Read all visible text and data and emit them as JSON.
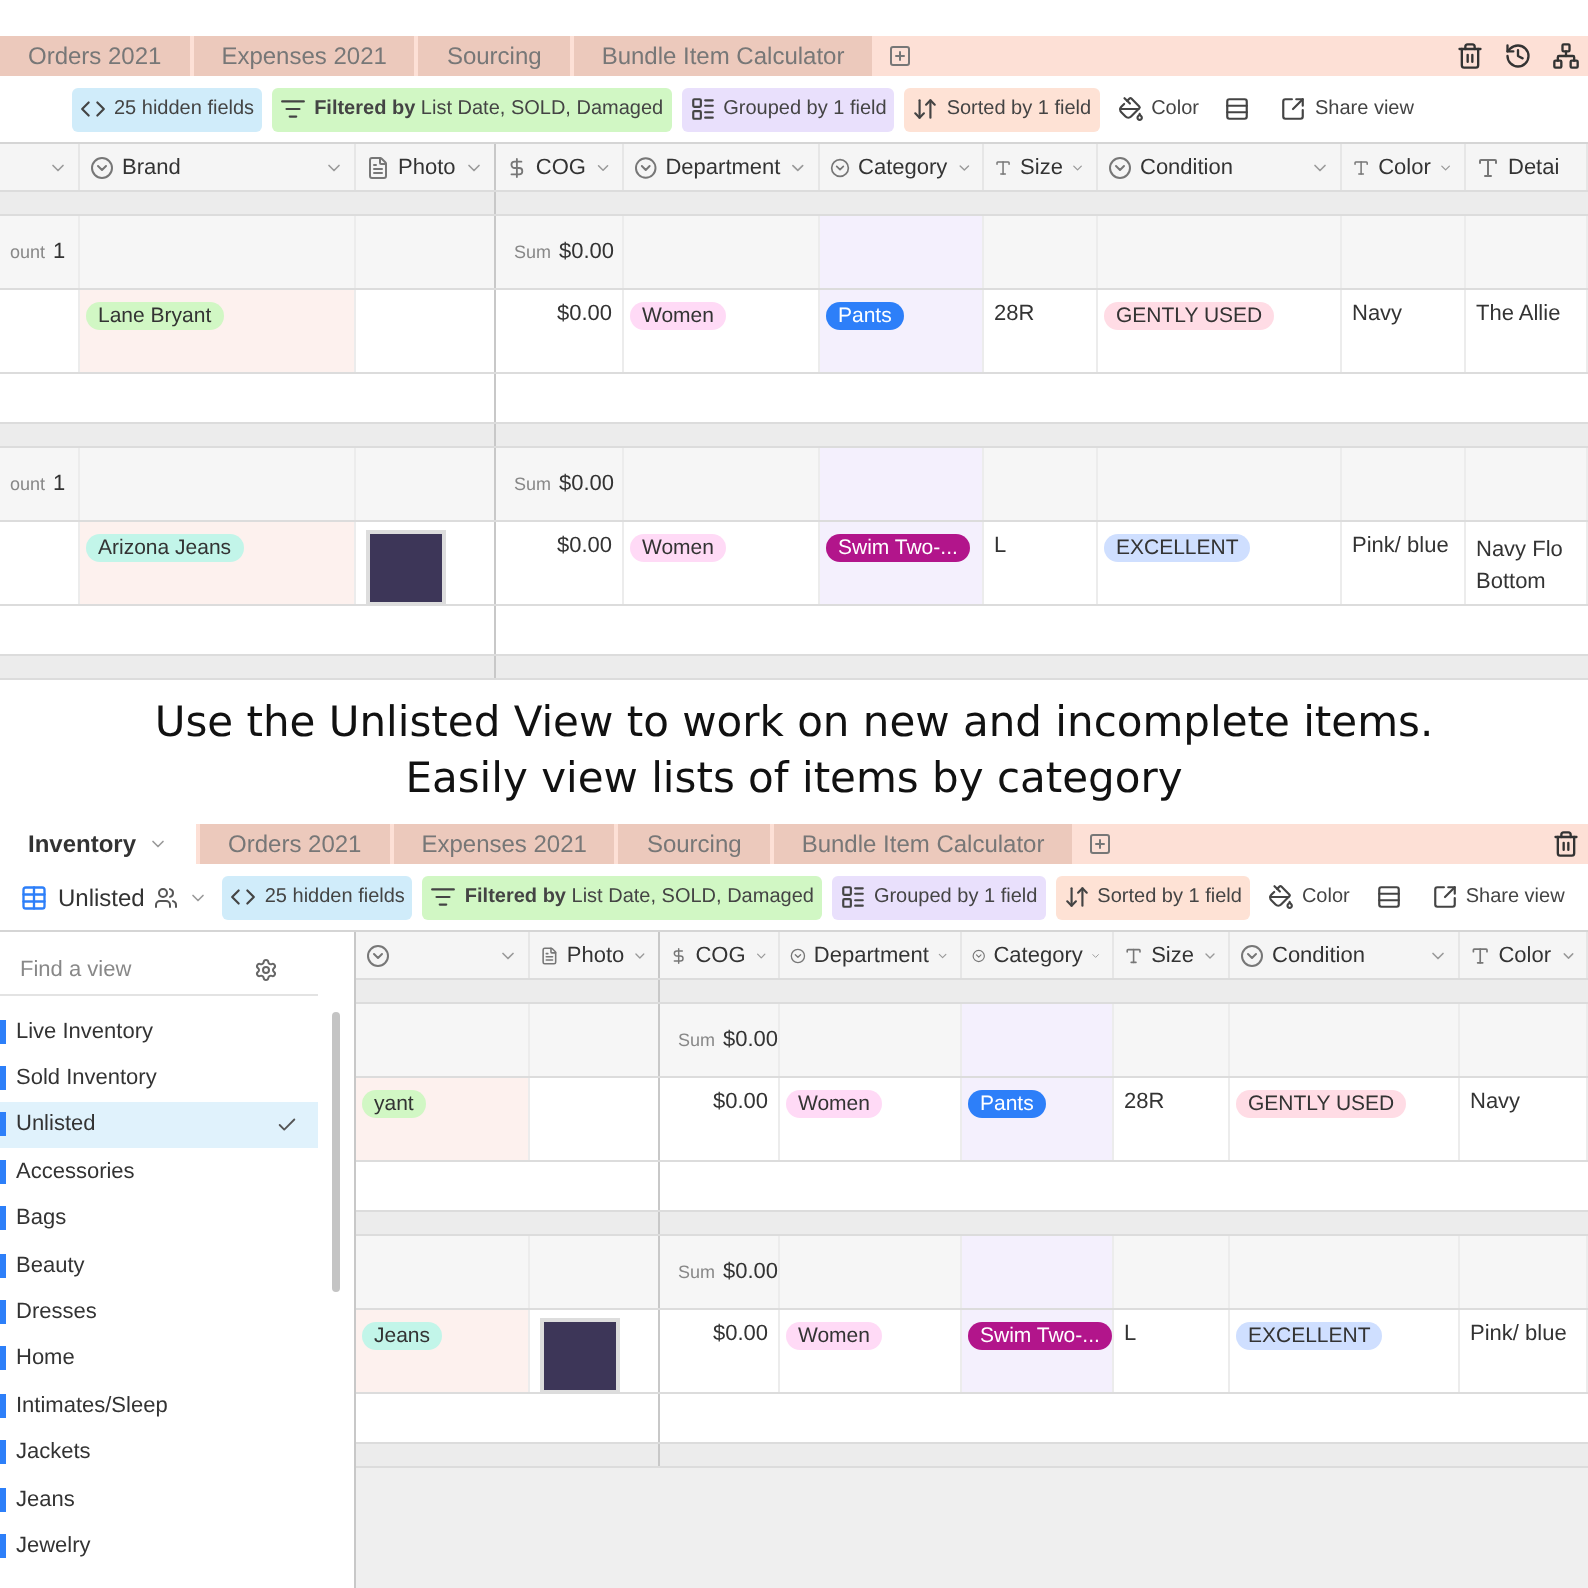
{
  "top_view": {
    "tabs": [
      {
        "label": "Orders 2021",
        "selected": false
      },
      {
        "label": "Expenses 2021",
        "selected": false
      },
      {
        "label": "Sourcing",
        "selected": false
      },
      {
        "label": "Bundle Item Calculator",
        "selected": false
      }
    ],
    "toolbar": [
      {
        "kind": "hidden",
        "label": "25 hidden fields"
      },
      {
        "kind": "filter",
        "label": "**Filtered by** List Date, SOLD, Damaged"
      },
      {
        "kind": "group",
        "label": "Grouped by 1 field"
      },
      {
        "kind": "sort",
        "label": "Sorted by 1 field"
      },
      {
        "kind": "color",
        "label": "Color"
      },
      {
        "kind": "row_height"
      },
      {
        "kind": "share",
        "label": "Share view"
      }
    ],
    "columns": [
      {
        "kind": "primary"
      },
      {
        "kind": "select",
        "label": "Brand",
        "sorted": true
      },
      {
        "kind": "attachment",
        "label": "Photo"
      },
      {
        "kind": "currency",
        "label": "COG"
      },
      {
        "kind": "select",
        "label": "Department"
      },
      {
        "kind": "select",
        "label": "Category",
        "grouped": true
      },
      {
        "kind": "text",
        "label": "Size"
      },
      {
        "kind": "select",
        "label": "Condition"
      },
      {
        "kind": "text",
        "label": "Color"
      },
      {
        "kind": "text",
        "label": "Detai"
      }
    ],
    "groups": [
      {
        "count_label": "ount",
        "count": "1",
        "sum_label": "Sum",
        "sum": "$0.00",
        "cells": [
          null,
          {
            "kind": "pill",
            "text": "Lane Bryant",
            "color": "#d1f7c4"
          },
          null,
          {
            "kind": "text",
            "text": "$0.00"
          },
          {
            "kind": "pill",
            "text": "Women",
            "color": "#ffdaf6"
          },
          {
            "kind": "pill",
            "text": "Pants",
            "color": "#2d7ff9"
          },
          {
            "kind": "text",
            "text": "28R"
          },
          {
            "kind": "pill",
            "text": "GENTLY USED",
            "color": "#ffdce5"
          },
          {
            "kind": "text",
            "text": "Navy"
          },
          {
            "kind": "text",
            "text": "The Allie"
          }
        ]
      },
      {
        "count_label": "ount",
        "count": "1",
        "sum_label": "Sum",
        "sum": "$0.00",
        "cells": [
          null,
          {
            "kind": "pill",
            "text": "Arizona Jeans",
            "color": "#c2f5e9"
          },
          {
            "kind": "photo"
          },
          {
            "kind": "text",
            "text": "$0.00"
          },
          {
            "kind": "pill",
            "text": "Women",
            "color": "#ffdaf6"
          },
          {
            "kind": "pill",
            "text": "Swim Two-...",
            "color": "#b2158b"
          },
          {
            "kind": "text",
            "text": "L"
          },
          {
            "kind": "pill",
            "text": "EXCELLENT",
            "color": "#cfdfff"
          },
          {
            "kind": "text",
            "text": "Pink/ blue"
          },
          {
            "kind": "lines",
            "lines": [
              "Navy Flo",
              "Bottom"
            ]
          }
        ]
      }
    ]
  },
  "caption": [
    "Use the Unlisted View to work on new and incomplete items.",
    "Easily view lists of items by category"
  ],
  "bottom_view": {
    "tabs": [
      {
        "label": "Inventory",
        "selected": true
      },
      {
        "label": "Orders 2021",
        "selected": false
      },
      {
        "label": "Expenses 2021",
        "selected": false
      },
      {
        "label": "Sourcing",
        "selected": false
      },
      {
        "label": "Bundle Item Calculator",
        "selected": false
      }
    ],
    "toolbar": [
      {
        "kind": "view",
        "label": "Unlisted"
      },
      {
        "kind": "hidden",
        "label": "25 hidden fields"
      },
      {
        "kind": "filter",
        "label": "**Filtered by** List Date, SOLD, Damaged"
      },
      {
        "kind": "group",
        "label": "Grouped by 1 field"
      },
      {
        "kind": "sort",
        "label": "Sorted by 1 field"
      },
      {
        "kind": "color",
        "label": "Color"
      },
      {
        "kind": "row_height"
      },
      {
        "kind": "share",
        "label": "Share view"
      }
    ],
    "sidebar": {
      "placeholder": "Find a view",
      "views": [
        {
          "label": "Live Inventory",
          "selected": false
        },
        {
          "label": "Sold Inventory",
          "selected": false
        },
        {
          "label": "Unlisted",
          "selected": true
        },
        {
          "label": "Accessories",
          "selected": false
        },
        {
          "label": "Bags",
          "selected": false
        },
        {
          "label": "Beauty",
          "selected": false
        },
        {
          "label": "Dresses",
          "selected": false
        },
        {
          "label": "Home",
          "selected": false
        },
        {
          "label": "Intimates/Sleep",
          "selected": false
        },
        {
          "label": "Jackets",
          "selected": false
        },
        {
          "label": "Jeans",
          "selected": false
        },
        {
          "label": "Jewelry",
          "selected": false
        }
      ]
    },
    "columns": [
      {
        "kind": "select",
        "sorted": true
      },
      {
        "kind": "attachment",
        "label": "Photo"
      },
      {
        "kind": "currency",
        "label": "COG"
      },
      {
        "kind": "select",
        "label": "Department"
      },
      {
        "kind": "select",
        "label": "Category",
        "grouped": true
      },
      {
        "kind": "text",
        "label": "Size"
      },
      {
        "kind": "select",
        "label": "Condition"
      },
      {
        "kind": "text",
        "label": "Color"
      }
    ],
    "groups": [
      {
        "sum_label": "Sum",
        "sum": "$0.00",
        "cells": [
          {
            "kind": "pill",
            "text": "yant",
            "color": "#d1f7c4"
          },
          null,
          {
            "kind": "text",
            "text": "$0.00"
          },
          {
            "kind": "pill",
            "text": "Women",
            "color": "#ffdaf6"
          },
          {
            "kind": "pill",
            "text": "Pants",
            "color": "#2d7ff9"
          },
          {
            "kind": "text",
            "text": "28R"
          },
          {
            "kind": "pill",
            "text": "GENTLY USED",
            "color": "#ffdce5"
          },
          {
            "kind": "text",
            "text": "Navy"
          }
        ]
      },
      {
        "sum_label": "Sum",
        "sum": "$0.00",
        "cells": [
          {
            "kind": "pill",
            "text": "Jeans",
            "color": "#c2f5e9"
          },
          {
            "kind": "photo"
          },
          {
            "kind": "text",
            "text": "$0.00"
          },
          {
            "kind": "pill",
            "text": "Women",
            "color": "#ffdaf6"
          },
          {
            "kind": "pill",
            "text": "Swim Two-...",
            "color": "#b2158b"
          },
          {
            "kind": "text",
            "text": "L"
          },
          {
            "kind": "pill",
            "text": "EXCELLENT",
            "color": "#cfdfff"
          },
          {
            "kind": "text",
            "text": "Pink/ blue"
          }
        ]
      }
    ]
  }
}
